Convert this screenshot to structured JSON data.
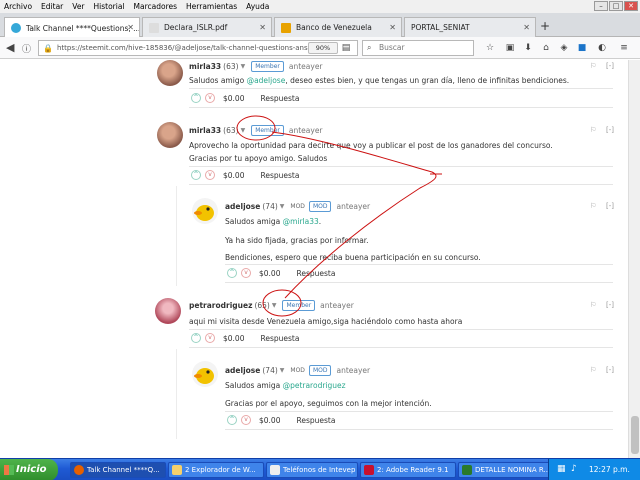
{
  "menu": [
    "Archivo",
    "Editar",
    "Ver",
    "Historial",
    "Marcadores",
    "Herramientas",
    "Ayuda"
  ],
  "tabs": [
    {
      "label": "Talk Channel ****Questions, ...",
      "active": true
    },
    {
      "label": "Declara_ISLR.pdf",
      "active": false
    },
    {
      "label": "Banco de Venezuela",
      "active": false
    },
    {
      "label": "PORTAL_SENIAT",
      "active": false
    }
  ],
  "nav": {
    "url": "https://steemit.com/hive-185836/@adeljose/talk-channel-questions-answe",
    "zoom": "90%",
    "search_placeholder": "Buscar"
  },
  "comments": [
    {
      "author": "mirla33",
      "rep": "(63)",
      "badge": "Member",
      "community": "anteayer",
      "lines": [
        {
          "pre": "Saludos amigo ",
          "mention": "@adeljose",
          "post": ", deseo estes bien, y que tengas un gran día, lleno de infinitas bendiciones."
        }
      ],
      "payout": "$0.00",
      "reply_label": "Respuesta"
    },
    {
      "author": "mirla33",
      "rep": "(63)",
      "badge": "Member",
      "community": "anteayer",
      "lines": [
        {
          "pre": "Aprovecho la oportunidad para decirte que voy a publicar el post de los ganadores del concurso."
        },
        {
          "pre": "Gracias por tu apoyo amigo. Saludos"
        }
      ],
      "payout": "$0.00",
      "reply_label": "Respuesta"
    },
    {
      "author": "adeljose",
      "rep": "(74)",
      "mod_label": "MOD",
      "badge": "MOD",
      "community": "anteayer",
      "lines": [
        {
          "pre": "Saludos amiga ",
          "mention": "@mirla33",
          "post": "."
        },
        {
          "pre": "Ya ha sido fijada, gracias por informar."
        },
        {
          "pre": "Bendiciones, espero que reciba buena participación en su concurso."
        }
      ],
      "payout": "$0.00",
      "reply_label": "Respuesta"
    },
    {
      "author": "petrarodriguez",
      "rep": "(65)",
      "badge": "Member",
      "community": "anteayer",
      "lines": [
        {
          "pre": "aqui mi visita desde Venezuela amigo,siga haciéndolo como hasta ahora"
        }
      ],
      "payout": "$0.00",
      "reply_label": "Respuesta"
    },
    {
      "author": "adeljose",
      "rep": "(74)",
      "mod_label": "MOD",
      "badge": "MOD",
      "community": "anteayer",
      "lines": [
        {
          "pre": "Saludos amiga ",
          "mention": "@petrarodriguez"
        },
        {
          "pre": "Gracias por el apoyo, seguimos con la mejor intención."
        }
      ],
      "payout": "$0.00",
      "reply_label": "Respuesta"
    }
  ],
  "taskbar": {
    "start": "Inicio",
    "items": [
      "Talk Channel ****Q...",
      "2 Explorador de W...",
      "Teléfonos de Intevep",
      "2: Adobe Reader 9.1",
      "DETALLE NOMINA R..."
    ],
    "lang": "ES",
    "clock": "12:27 p.m."
  },
  "colors": {
    "mention": "#2ba88e",
    "badge": "#3a75b3",
    "annotation": "#cc1111"
  }
}
